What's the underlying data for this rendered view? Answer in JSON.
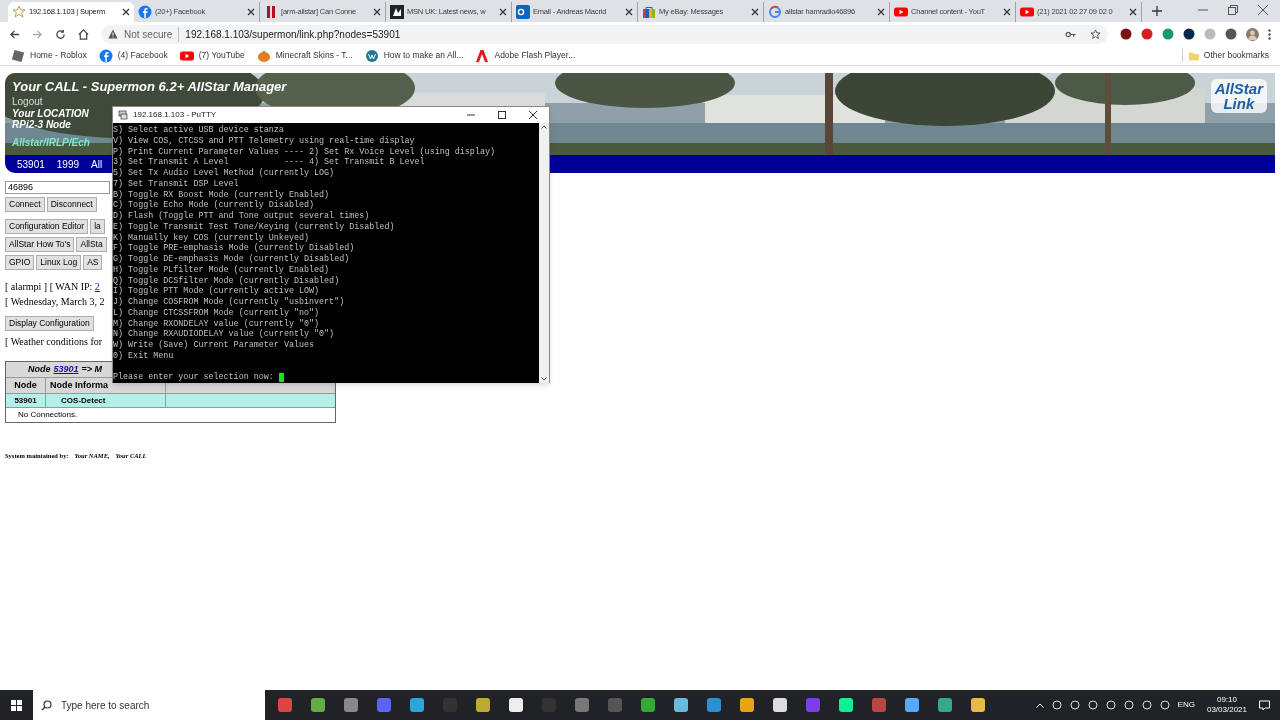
{
  "browser": {
    "tabs": [
      {
        "title": "192.168.1.103 | Superm",
        "kind": "star",
        "selected": true
      },
      {
        "title": "(20+) Facebook",
        "kind": "facebook",
        "selected": false
      },
      {
        "title": "[arm-allstar] Can Conne",
        "kind": "bars",
        "selected": false
      },
      {
        "title": "MSN UK: Latest news, w",
        "kind": "msn",
        "selected": false
      },
      {
        "title": "Email - Andreas Macrid",
        "kind": "outlook",
        "selected": false
      },
      {
        "title": "My eBay: Messages",
        "kind": "bag",
        "selected": false
      },
      {
        "title": "allstar hamradio46896",
        "kind": "google",
        "selected": false
      },
      {
        "title": "Channel content - YouT",
        "kind": "youtube",
        "selected": false
      },
      {
        "title": "(21) 2021 02 27 09 02 0",
        "kind": "youtube",
        "selected": false
      }
    ],
    "security": "Not secure",
    "url": "192.168.1.103/supermon/link.php?nodes=53901",
    "bookmarks": [
      {
        "label": "Home - Roblox",
        "kind": "roblox"
      },
      {
        "label": "(4) Facebook",
        "kind": "facebook"
      },
      {
        "label": "(7) YouTube",
        "kind": "youtube"
      },
      {
        "label": "Minecraft Skins - T...",
        "kind": "pumpkin"
      },
      {
        "label": "How to make an All...",
        "kind": "wordpress"
      },
      {
        "label": "Adobe Flash Player...",
        "kind": "adobe"
      }
    ],
    "other_bookmarks": "Other bookmarks"
  },
  "page": {
    "title": "Your CALL - Supermon 6.2+ AllStar Manager",
    "logout": "Logout",
    "location": "Your LOCATION",
    "node_type": "RPi2-3 Node",
    "network": "Allstar/IRLP/Ech",
    "logo": [
      "AllStar",
      "Link"
    ],
    "status_bar": [
      "53901",
      "1999",
      "All"
    ],
    "node_input": "46896",
    "button_rows": [
      [
        "Connect",
        "Disconnect"
      ],
      [
        "Configuration Editor",
        "la"
      ],
      [
        "AllStar How To's",
        "AllSta"
      ],
      [
        "GPIO",
        "Linux Log",
        "AS"
      ]
    ],
    "host_line": {
      "text": "[ alarmpi ] [ WAN IP: ",
      "link": "2"
    },
    "date_line": "[ Wednesday, March 3, 2",
    "display_button": "Display Configuration",
    "weather_line": "[ Weather conditions for",
    "table": {
      "caption": "Node",
      "caption_link": "53901",
      "caption_rest": "=> M",
      "columns": [
        "Node",
        "Node Informa"
      ],
      "rows": [
        [
          "53901",
          "COS-Detect"
        ]
      ],
      "empty": "No Connections."
    },
    "footer": {
      "label": "System maintained by:",
      "name": "Your NAME,",
      "call": "Your CALL"
    }
  },
  "putty": {
    "title": "192.168.1.103 - PuTTY",
    "lines": [
      "S) Select active USB device stanza",
      "V) View COS, CTCSS and PTT Telemetry using real-time display",
      "P) Print Current Parameter Values ---- 2) Set Rx Voice Level (using display)",
      "3) Set Transmit A Level           ---- 4) Set Transmit B Level",
      "5) Set Tx Audio Level Method (currently LOG)",
      "7) Set Transmit DSP Level",
      "B) Toggle RX Boost Mode (currently Enabled)",
      "C) Toggle Echo Mode (currently Disabled)",
      "D) Flash (Toggle PTT and Tone output several times)",
      "E) Toggle Transmit Test Tone/Keying (currently Disabled)",
      "K) Manually key COS (currently Unkeyed)",
      "F) Toggle PRE-emphasis Mode (currently Disabled)",
      "G) Toggle DE-emphasis Mode (currently Disabled)",
      "H) Toggle PLfilter Mode (currently Enabled)",
      "Q) Toggle DCSfilter Mode (currently Disabled)",
      "I) Toggle PTT Mode (currently active LOW)",
      "J) Change COSFROM Mode (currently \"usbinvert\")",
      "L) Change CTCSSFROM Mode (currently \"no\")",
      "M) Change RXONDELAY value (currently \"0\")",
      "N) Change RXAUDIODELAY value (currently \"0\")",
      "W) Write (Save) Current Parameter Values",
      "0) Exit Menu"
    ],
    "prompt": "Please enter your selection now: "
  },
  "taskbar": {
    "search_placeholder": "Type here to search",
    "language": "ENG",
    "time": "09:10",
    "date": "03/03/2021"
  }
}
